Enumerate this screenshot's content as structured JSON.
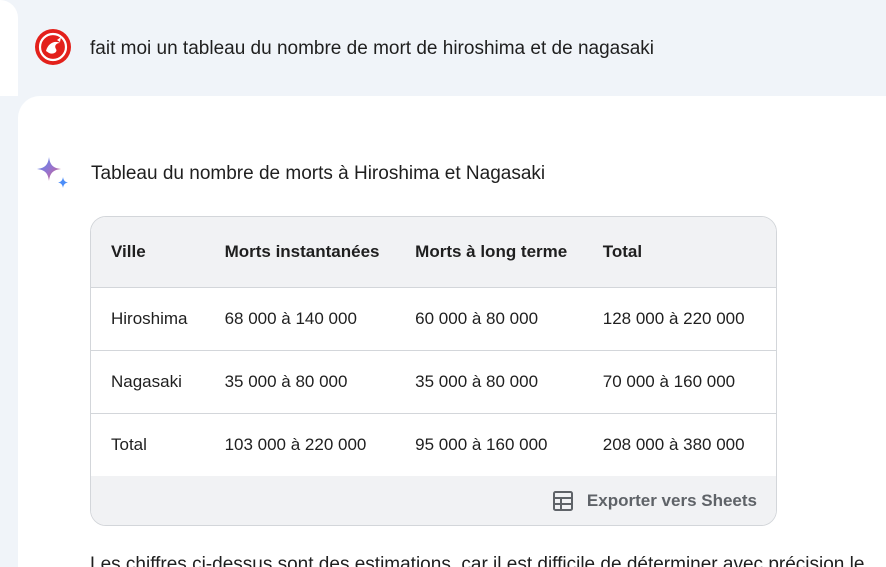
{
  "prompt": {
    "text": "fait moi un tableau du nombre de mort de hiroshima et de nagasaki"
  },
  "response": {
    "title": "Tableau du nombre de morts à Hiroshima et Nagasaki",
    "table": {
      "headers": [
        "Ville",
        "Morts instantanées",
        "Morts à long terme",
        "Total"
      ],
      "rows": [
        [
          "Hiroshima",
          "68 000 à 140 000",
          "60 000 à 80 000",
          "128 000 à 220 000"
        ],
        [
          "Nagasaki",
          "35 000 à 80 000",
          "35 000 à 80 000",
          "70 000 à 160 000"
        ],
        [
          "Total",
          "103 000 à 220 000",
          "95 000 à 160 000",
          "208 000 à 380 000"
        ]
      ],
      "export_label": "Exporter vers Sheets"
    },
    "following_text": "Les chiffres ci-dessus sont des estimations, car il est difficile de déterminer avec précision le"
  },
  "icons": {
    "avatar": "red-dragon-avatar-icon",
    "assistant": "sparkle-icon",
    "export": "sheets-table-icon"
  },
  "colors": {
    "avatar_bg": "#e3201b",
    "header_bg": "#f1f2f4",
    "border": "#d3d6da"
  }
}
